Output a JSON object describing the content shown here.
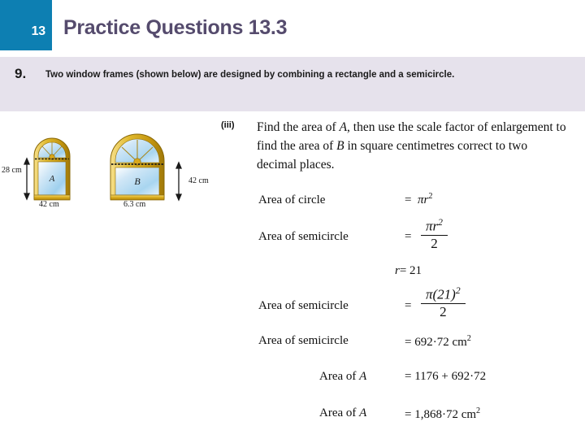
{
  "header": {
    "chapter_number": "13",
    "title": "Practice Questions 13.3",
    "badge_color": "#0d7fb2",
    "title_color": "#554b6d"
  },
  "question": {
    "number": "9.",
    "text": "Two window frames (shown below) are designed by combining a rectangle and a semicircle.",
    "band_color": "#e6e2ec"
  },
  "diagram": {
    "window_a": {
      "glass_label": "A",
      "height_label": "28 cm",
      "width_label": "42 cm"
    },
    "window_b": {
      "glass_label": "B",
      "height_label": "42 cm",
      "width_label": "6.3 cm"
    },
    "frame_color": "#d9a81b",
    "glass_color": "#bfe0f2"
  },
  "part": {
    "label": "(iii)",
    "text_1": "Find the area of ",
    "italic_a": "A",
    "text_2": ", then use the scale factor of enlargement to find the area of ",
    "italic_b": "B",
    "text_3": " in square centimetres correct to two decimal places."
  },
  "math": {
    "row1": {
      "label": "Area of circle",
      "eq": "=",
      "value_pi": "π",
      "value_r": "r",
      "value_sup": "2"
    },
    "row2": {
      "label": "Area of semicircle",
      "eq": "=",
      "num_pi": "π",
      "num_r": "r",
      "num_sup": "2",
      "den": "2"
    },
    "row3": {
      "r_sym": "r",
      "r_eq": "= 21"
    },
    "row4": {
      "label": "Area of semicircle",
      "eq": "=",
      "num": "π(21)",
      "num_sup": "2",
      "den": "2"
    },
    "row5": {
      "label": "Area of semicircle",
      "value": "= 692·72 cm",
      "value_sup": "2"
    },
    "row6": {
      "label_pre": "Area of ",
      "label_italic": "A",
      "value": "= 1176 + 692·72"
    },
    "row7": {
      "label_pre": "Area of ",
      "label_italic": "A",
      "value": "= 1,868·72 cm",
      "value_sup": "2"
    }
  }
}
